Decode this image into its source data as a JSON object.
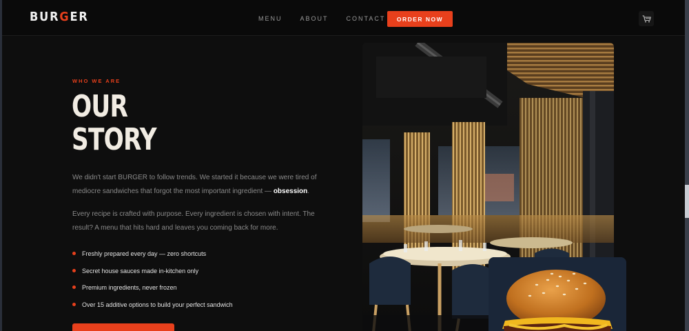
{
  "nav": {
    "logo_pre": "BUR",
    "logo_accent": "G",
    "logo_post": "ER",
    "links": [
      "MENU",
      "ABOUT",
      "CONTACT"
    ],
    "order_label": "ORDER NOW",
    "cart_icon": "cart-icon"
  },
  "story": {
    "eyebrow": "WHO WE ARE",
    "title_line1": "OUR",
    "title_line2": "STORY",
    "p1_text": "We didn't start BURGER to follow trends. We started it because we were tired of mediocre sandwiches that forgot the most important ingredient — ",
    "p1_bold": "obsession",
    "p1_end": ".",
    "p2": "Every recipe is crafted with purpose. Every ingredient is chosen with intent. The result? A menu that hits hard and leaves you coming back for more.",
    "bullets": [
      "Freshly prepared every day — zero shortcuts",
      "Secret house sauces made in-kitchen only",
      "Premium ingredients, never frozen",
      "Over 15 additive options to build your perfect sandwich"
    ]
  },
  "colors": {
    "accent": "#e8401c",
    "background": "#0e0e0e",
    "title": "#f1ece3"
  }
}
